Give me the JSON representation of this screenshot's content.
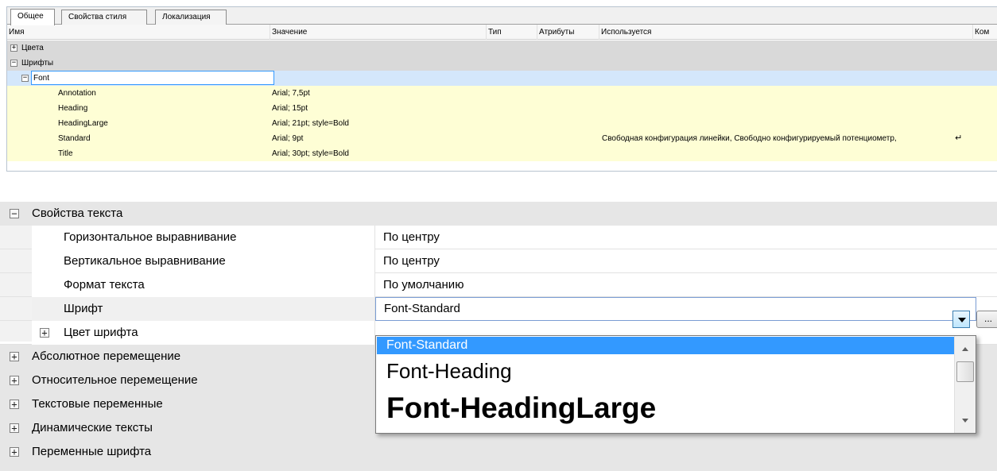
{
  "tabs": [
    {
      "label": "Общее"
    },
    {
      "label": "Свойства стиля"
    },
    {
      "label": "Локализация"
    }
  ],
  "grid": {
    "columns": [
      "Имя",
      "Значение",
      "Тип",
      "Атрибуты",
      "Используется",
      "Ком"
    ],
    "groups": {
      "colors": "Цвета",
      "fonts": "Шрифты",
      "font": "Font"
    },
    "rows": [
      {
        "name": "Annotation",
        "value": "Arial; 7,5pt",
        "used": ""
      },
      {
        "name": "Heading",
        "value": "Arial; 15pt",
        "used": ""
      },
      {
        "name": "HeadingLarge",
        "value": "Arial; 21pt; style=Bold",
        "used": ""
      },
      {
        "name": "Standard",
        "value": "Arial; 9pt",
        "used": "Свободная конфигурация линейки, Свободно конфигурируемый потенциометр,"
      },
      {
        "name": "Title",
        "value": "Arial; 30pt; style=Bold",
        "used": ""
      }
    ]
  },
  "props": {
    "text_props": "Свойства текста",
    "h_align": {
      "label": "Горизонтальное выравнивание",
      "value": "По центру"
    },
    "v_align": {
      "label": "Вертикальное выравнивание",
      "value": "По центру"
    },
    "text_format": {
      "label": "Формат текста",
      "value": "По умолчанию"
    },
    "font": {
      "label": "Шрифт",
      "value": "Font-Standard"
    },
    "font_color": "Цвет шрифта",
    "categories": [
      "Абсолютное перемещение",
      "Относительное перемещение",
      "Текстовые переменные",
      "Динамические тексты",
      "Переменные шрифта"
    ],
    "ellipsis": "..."
  },
  "dropdown": {
    "options": [
      "Font-Standard",
      "Font-Heading",
      "Font-HeadingLarge"
    ]
  },
  "colors": {
    "selection": "#3399ff",
    "yellow_row": "#fefed5",
    "group_row": "#d9d9d9"
  }
}
